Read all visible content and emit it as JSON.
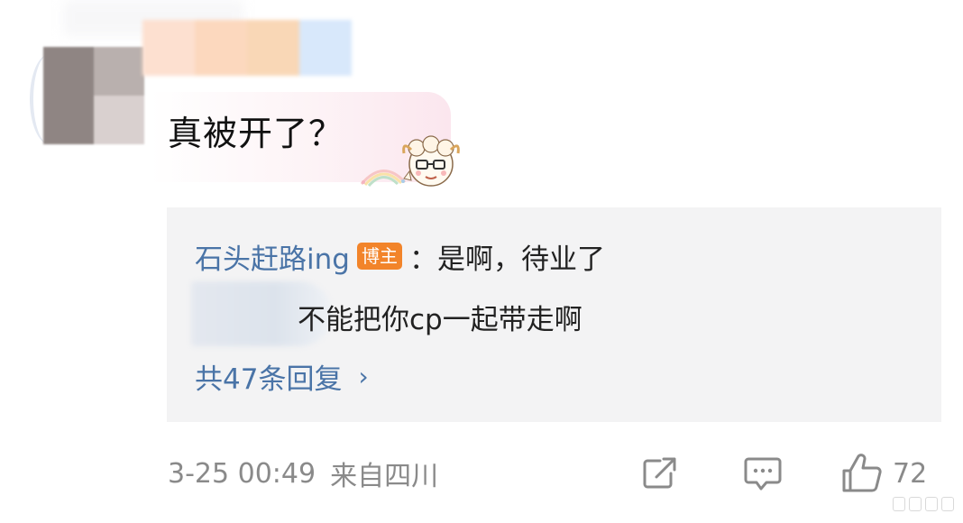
{
  "comment": {
    "text": "真被开了？"
  },
  "reply": {
    "author": "石头赶路ing",
    "author_badge": "博主",
    "colon": "：",
    "text": "是啊，待业了",
    "second_reply_text": "不能把你cp一起带走啊",
    "reply_count_label": "共47条回复",
    "chevron": "›"
  },
  "footer": {
    "time": "3-25 00:49",
    "location": "来自四川",
    "like_count": "72"
  },
  "icons": {
    "share": "share-icon",
    "comment": "comment-icon",
    "like": "like-icon",
    "sticker": "sheep-sticker"
  },
  "colors": {
    "link_blue": "#4a74a7",
    "badge_orange": "#f2842a",
    "meta_gray": "#8a8a8a",
    "card_bg": "#f3f3f4"
  }
}
